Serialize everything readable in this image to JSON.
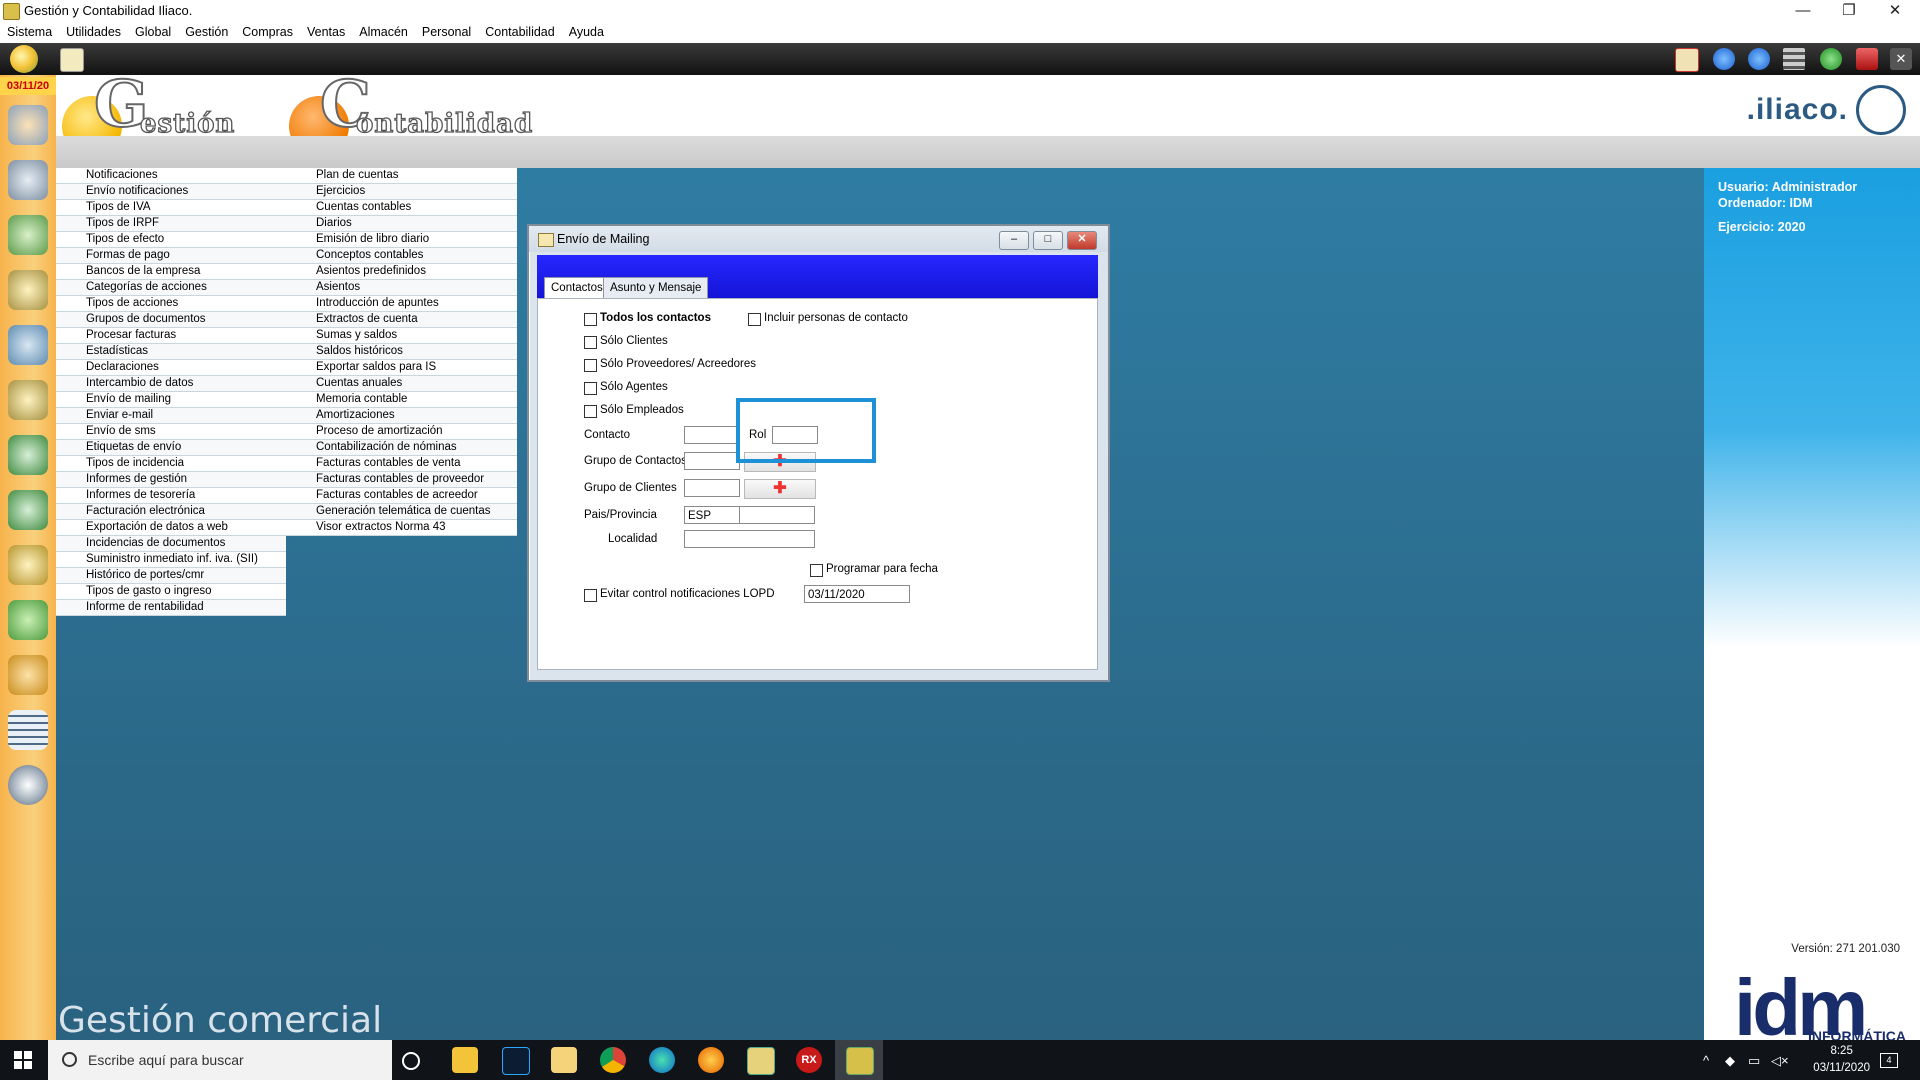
{
  "window": {
    "title": "Gestión y Contabilidad Iliaco.",
    "minimize": "—",
    "restore": "❐",
    "close": "✕"
  },
  "menubar": [
    "Sistema",
    "Utilidades",
    "Global",
    "Gestión",
    "Compras",
    "Ventas",
    "Almacén",
    "Personal",
    "Contabilidad",
    "Ayuda"
  ],
  "rail": {
    "date": "03/11/20"
  },
  "header": {
    "gestion_letter": "G",
    "gestion_word": "estión",
    "contab_letter": "C",
    "contab_word": "ontabilidad",
    "brand": ".iliaco."
  },
  "gestion_menu": [
    "Notificaciones",
    "Envío notificaciones",
    "Tipos de IVA",
    "Tipos de IRPF",
    "Tipos de efecto",
    "Formas de pago",
    "Bancos de la empresa",
    "Categorías de acciones",
    "Tipos de acciones",
    "Grupos de documentos",
    "Procesar facturas",
    "Estadísticas",
    "Declaraciones",
    "Intercambio de datos",
    "Envío de mailing",
    "Enviar e-mail",
    "Envío de sms",
    "Etiquetas de envío",
    "Tipos de incidencia",
    "Informes de gestión",
    "Informes de tesorería",
    "Facturación electrónica",
    "Exportación de datos a web",
    "Incidencias de documentos",
    "Suministro inmediato inf. iva. (SII)",
    "Histórico de portes/cmr",
    "Tipos de gasto o ingreso",
    "Informe de rentabilidad"
  ],
  "contab_menu": [
    "Plan de cuentas",
    "Ejercicios",
    "Cuentas contables",
    "Diarios",
    "Emisión de libro diario",
    "Conceptos contables",
    "Asientos predefinidos",
    "Asientos",
    "Introducción de apuntes",
    "Extractos de cuenta",
    "Sumas y saldos",
    "Saldos históricos",
    "Exportar saldos para IS",
    "Cuentas anuales",
    "Memoria contable",
    "Amortizaciones",
    "Proceso de amortización",
    "Contabilización de nóminas",
    "Facturas contables de venta",
    "Facturas contables de proveedor",
    "Facturas contables de acreedor",
    "Generación telemática de cuentas",
    "Visor extractos Norma 43"
  ],
  "footer_label": "Gestión comercial",
  "info": {
    "usuario": "Usuario: Administrador",
    "ordenador": "Ordenador: IDM",
    "ejercicio": "Ejercicio: 2020",
    "version": "Versión: 271 201.030",
    "idm": "idm",
    "idm_sub": "INFORMÁTICA"
  },
  "dialog": {
    "title": "Envío de Mailing",
    "tabs": [
      "Contactos",
      "Asunto y Mensaje"
    ],
    "todos": "Todos los contactos",
    "incluir": "Incluir personas de contacto",
    "solo_clientes": "Sólo Clientes",
    "solo_proveedores": "Sólo Proveedores/ Acreedores",
    "solo_agentes": "Sólo Agentes",
    "solo_empleados": "Sólo Empleados",
    "contacto": "Contacto",
    "rol": "Rol",
    "grupo_contactos": "Grupo de Contactos",
    "grupo_clientes": "Grupo de Clientes",
    "pais_provincia": "Pais/Provincia",
    "pais_value": "ESP",
    "localidad": "Localidad",
    "programar": "Programar para fecha",
    "evitar": "Evitar control notificaciones LOPD",
    "fecha_value": "03/11/2020"
  },
  "taskbar": {
    "search_placeholder": "Escribe aquí para buscar",
    "time": "8:25",
    "date": "03/11/2020",
    "notif_count": "4"
  }
}
